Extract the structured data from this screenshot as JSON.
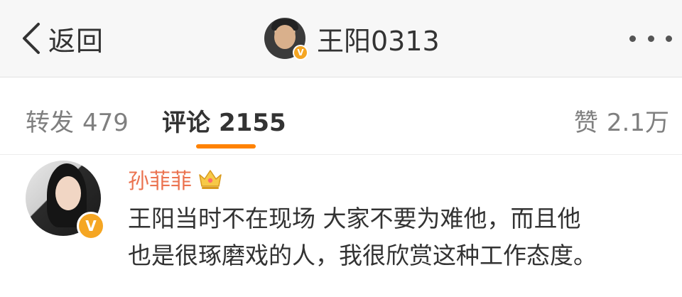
{
  "navbar": {
    "back_label": "返回",
    "title": "王阳0313",
    "verified_badge": "V"
  },
  "tabs": {
    "repost": {
      "label": "转发",
      "count": "479"
    },
    "comment": {
      "label": "评论",
      "count": "2155"
    },
    "like": {
      "label": "赞",
      "count": "2.1万"
    },
    "active": "comment"
  },
  "comment": {
    "username": "孙菲菲",
    "verified_badge": "V",
    "text_line1": "王阳当时不在现场 大家不要为难他，而且他",
    "text_line2": "也是很琢磨戏的人，我很欣赏这种工作态度。"
  },
  "colors": {
    "accent": "#ff8200",
    "username": "#eb7350",
    "badge": "#f5a623"
  },
  "icons": [
    "chevron-left-icon",
    "more-icon",
    "crown-icon",
    "verified-icon"
  ]
}
